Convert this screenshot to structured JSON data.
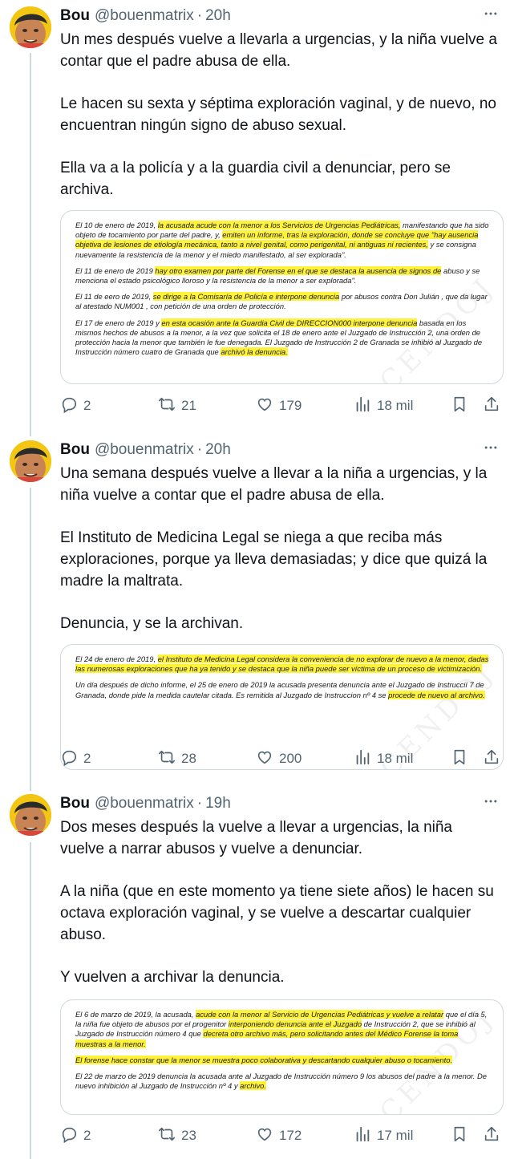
{
  "tweets": [
    {
      "name": "Bou",
      "handle": "@bouenmatrix",
      "separator": "·",
      "time": "20h",
      "paragraphs": [
        "Un mes después vuelve a llevarla a urgencias, y la niña vuelve a contar que el padre abusa de ella.",
        "Le hacen su sexta y séptima exploración vaginal, y de nuevo, no encuentran ningún signo de abuso sexual.",
        "Ella va a la policía y a la guardia civil a denunciar, pero se archiva."
      ],
      "doc_paragraphs": [
        [
          {
            "t": "El 10 de enero de 2019, "
          },
          {
            "t": "la acusada acude con la menor a los Servicios de Urgencias Pediátricas,",
            "h": true
          },
          {
            "t": " manifestando que ha sido objeto de tocamiento por parte del padre, y, "
          },
          {
            "t": "emiten un informe, tras la exploración, donde se concluye que \"hay ausencia objetiva de lesiones de etiología mecánica, tanto a nivel genital, como perigenital, ni antiguas ni recientes,",
            "h": true
          },
          {
            "t": " y se consigna nuevamente la resistencia de la menor y el miedo manifestado, al ser explorada\"."
          }
        ],
        [
          {
            "t": "El 11 de enero de 2019 "
          },
          {
            "t": "hay otro examen por parte del Forense en el que se destaca la ausencia de signos de",
            "h": true
          },
          {
            "t": " abuso y se menciona el estado psicológico lloroso y la resistencia de la menor a ser explorada\"."
          }
        ],
        [
          {
            "t": "El 11 de eero de 2019, "
          },
          {
            "t": "se dirige a la Comisaría de Policía e interpone denuncia",
            "h": true
          },
          {
            "t": " por abusos contra Don  Julián , que da lugar al atestado  NUM001 , con petición de una orden de protección."
          }
        ],
        [
          {
            "t": "El 17 de enero de 2019 y "
          },
          {
            "t": "en esta ocasión ante la Guardia Civil de  DIRECCION000  interpone denuncia",
            "h": true
          },
          {
            "t": " basada en los mismos hechos de abusos a la menor, a la vez que solicita el 18 de enero ante el Juzgado de Instrucción 2, una orden de protección hacia la menor que también le fue denegada. El Juzgado de Instrucción 2 de Granada se inhibió al Juzgado de Instrucción número cuatro de Granada que "
          },
          {
            "t": "archivó la denuncia.",
            "h": true
          }
        ]
      ],
      "stats": {
        "replies": "2",
        "reposts": "21",
        "likes": "179",
        "views": "18 mil"
      }
    },
    {
      "name": "Bou",
      "handle": "@bouenmatrix",
      "separator": "·",
      "time": "20h",
      "paragraphs": [
        "Una semana después vuelve a llevar a la niña a urgencias, y la niña vuelve a contar que el padre abusa de ella.",
        "El Instituto de Medicina Legal se niega a que reciba más exploraciones, porque ya lleva demasiadas; y dice que quizá la madre la maltrata.",
        "Denuncia, y se la archivan."
      ],
      "doc_paragraphs": [
        [
          {
            "t": "El 24 de enero de 2019, "
          },
          {
            "t": "el Instituto de Medicina Legal considera la conveniencia de no explorar de nuevo a la menor, dadas las numerosas exploraciones que ha ya tenido y se destaca que la niña puede ser víctima de un proceso de victimización.",
            "h": true
          }
        ],
        [
          {
            "t": "Un día después de dicho informe, el 25 de enero de 2019 la acusada presenta denuncia ante el Juzgado de Instruccií 7 de Granada, donde pide la medida cautelar citada. Es remitida al Juzgado de Instruccion nº 4 se "
          },
          {
            "t": "procede de nuevo al archivo.",
            "h": true
          }
        ]
      ],
      "stats": {
        "replies": "2",
        "reposts": "28",
        "likes": "200",
        "views": "18 mil"
      }
    },
    {
      "name": "Bou",
      "handle": "@bouenmatrix",
      "separator": "·",
      "time": "19h",
      "paragraphs": [
        "Dos meses después la vuelve a llevar a urgencias, la niña vuelve a narrar abusos y vuelve a denunciar.",
        "A la niña (que en este momento ya tiene siete años) le hacen su octava exploración vaginal, y se vuelve a descartar cualquier abuso.",
        "Y vuelven a archivar la denuncia."
      ],
      "doc_paragraphs": [
        [
          {
            "t": "El 6 de marzo de 2019, la acusada, "
          },
          {
            "t": "acude con la menor al Servicio de Urgencias Pediátricas y vuelve a relatar",
            "h": true
          },
          {
            "t": " que el día 5, la niña fue objeto de abusos por el progenitor "
          },
          {
            "t": "interponiendo denuncia ante el Juzgado",
            "h": true
          },
          {
            "t": " de Instrucción 2, que se inhibió al Juzgado de Instrucción número 4 que "
          },
          {
            "t": "decreta otro archivo más, pero solicitando antes del Médico Forense la toma muestras a la menor.",
            "h": true
          }
        ],
        [
          {
            "t": "El forense hace constar que la menor se muestra poco colaborativa y descartando cualquier abuso o tocamiento.",
            "h": true
          }
        ],
        [
          {
            "t": "El 22 de marzo de 2019 denuncia la acusada ante al Juzgado de Instrucción número 9 los abusos del padre a la menor. De nuevo inhibición al Juzgado de Instrucción nº 4 y "
          },
          {
            "t": "archivo.",
            "h": true
          }
        ]
      ],
      "stats": {
        "replies": "2",
        "reposts": "23",
        "likes": "172",
        "views": "17 mil"
      }
    }
  ]
}
